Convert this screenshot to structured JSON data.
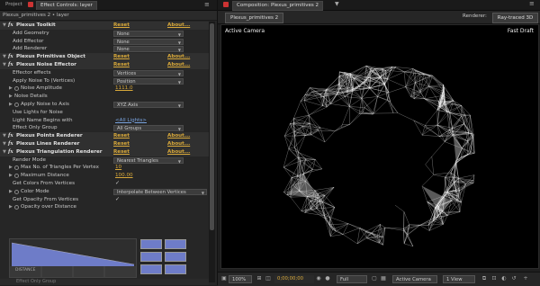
{
  "left_panel": {
    "tabs": [
      {
        "label": "Project"
      },
      {
        "label": "Effect Controls: layer"
      }
    ],
    "subtitle": "Plexus_primitives 2 • layer",
    "rows": [
      {
        "type": "header",
        "label": "Plexus Toolkit",
        "reset": "Reset",
        "about": "About..."
      },
      {
        "type": "dropdown",
        "label": "Add Geometry",
        "value": "None",
        "indent": 1
      },
      {
        "type": "dropdown",
        "label": "Add Effector",
        "value": "None",
        "indent": 1
      },
      {
        "type": "dropdown",
        "label": "Add Renderer",
        "value": "None",
        "indent": 1
      },
      {
        "type": "header",
        "label": "Plexus Primitives Object",
        "reset": "Reset",
        "about": "About..."
      },
      {
        "type": "header",
        "label": "Plexus Noise Effector",
        "reset": "Reset",
        "about": "About..."
      },
      {
        "type": "dropdown",
        "label": "Effector effects",
        "value": "Vertices",
        "indent": 1
      },
      {
        "type": "dropdown",
        "label": "Apply Noise To (Vertices)",
        "value": "Position",
        "indent": 1
      },
      {
        "type": "value",
        "label": "Noise Amplitude",
        "value": "1111.0",
        "indent": 1,
        "twirl": true,
        "stopwatch": true
      },
      {
        "type": "label",
        "label": "Noise Details",
        "indent": 1,
        "twirl": true
      },
      {
        "type": "dropdown",
        "label": "Apply Noise to Axis",
        "value": "XYZ Axis",
        "indent": 1,
        "twirl": true,
        "stopwatch": true
      },
      {
        "type": "checkbox",
        "label": "Use Lights for Noise",
        "value": "",
        "indent": 1
      },
      {
        "type": "link",
        "label": "Light Name Begins with",
        "value": "<All Lights>",
        "indent": 1
      },
      {
        "type": "dropdown",
        "label": "Effect Only Group",
        "value": "All Groups",
        "indent": 1
      },
      {
        "type": "header",
        "label": "Plexus Points Renderer",
        "reset": "Reset",
        "about": "About..."
      },
      {
        "type": "header",
        "label": "Plexus Lines Renderer",
        "reset": "Reset",
        "about": "About..."
      },
      {
        "type": "header",
        "label": "Plexus Triangulation Renderer",
        "reset": "Reset",
        "about": "About..."
      },
      {
        "type": "dropdown",
        "label": "Render Mode",
        "value": "Nearest Triangles",
        "indent": 1
      },
      {
        "type": "value",
        "label": "Max No. of Triangles Per Vertex",
        "value": "10",
        "indent": 1,
        "twirl": true,
        "stopwatch": true
      },
      {
        "type": "value",
        "label": "Maximum Distance",
        "value": "100.00",
        "indent": 1,
        "twirl": true,
        "stopwatch": true
      },
      {
        "type": "checkbox",
        "label": "Get Colors From Vertices",
        "value": "✓",
        "indent": 1
      },
      {
        "type": "dropdown",
        "label": "Color Mode",
        "value": "Interpolate Between Vertices",
        "indent": 1,
        "twirl": true,
        "stopwatch": true
      },
      {
        "type": "checkbox",
        "label": "Get Opacity From Vertices",
        "value": "✓",
        "indent": 1
      },
      {
        "type": "label",
        "label": "Opacity over Distance",
        "indent": 1,
        "twirl": true,
        "stopwatch": true
      }
    ],
    "graph_label": "DISTANCE",
    "bottom_partial": "Effect Only Group"
  },
  "composition": {
    "tab_label": "Composition: Plexus_primitives 2",
    "comp_tab": "Plexus_primitives 2",
    "renderer_label": "Renderer:",
    "renderer_value": "Ray-traced 3D",
    "view_label": "Active Camera",
    "draft_label": "Fast Draft",
    "bottom": {
      "zoom": "100%",
      "timecode": "0;00;00;00",
      "resolution": "Full",
      "camera": "Active Camera",
      "views": "1 View"
    }
  },
  "colors": {
    "accent": "#d9a93a",
    "link": "#7aa4e0",
    "graph_fill": "#6e7cc8"
  }
}
